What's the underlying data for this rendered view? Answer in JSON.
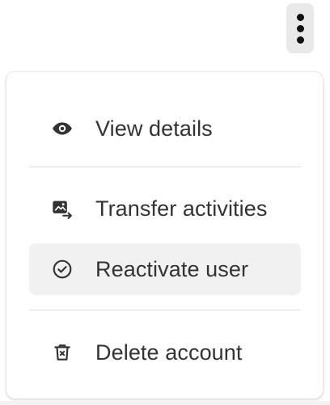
{
  "more_button": {
    "icon": "more-vertical-icon"
  },
  "menu": {
    "items": [
      {
        "label": "View details",
        "icon": "eye-icon",
        "highlighted": false
      },
      {
        "label": "Transfer activities",
        "icon": "transfer-icon",
        "highlighted": false
      },
      {
        "label": "Reactivate user",
        "icon": "check-circle-icon",
        "highlighted": true
      },
      {
        "label": "Delete account",
        "icon": "trash-icon",
        "highlighted": false
      }
    ]
  },
  "colors": {
    "text": "#333333",
    "icon": "#333333",
    "highlight_bg": "#f1f1f1",
    "kebab_bg": "#e9e9e9",
    "divider": "#dedede"
  }
}
